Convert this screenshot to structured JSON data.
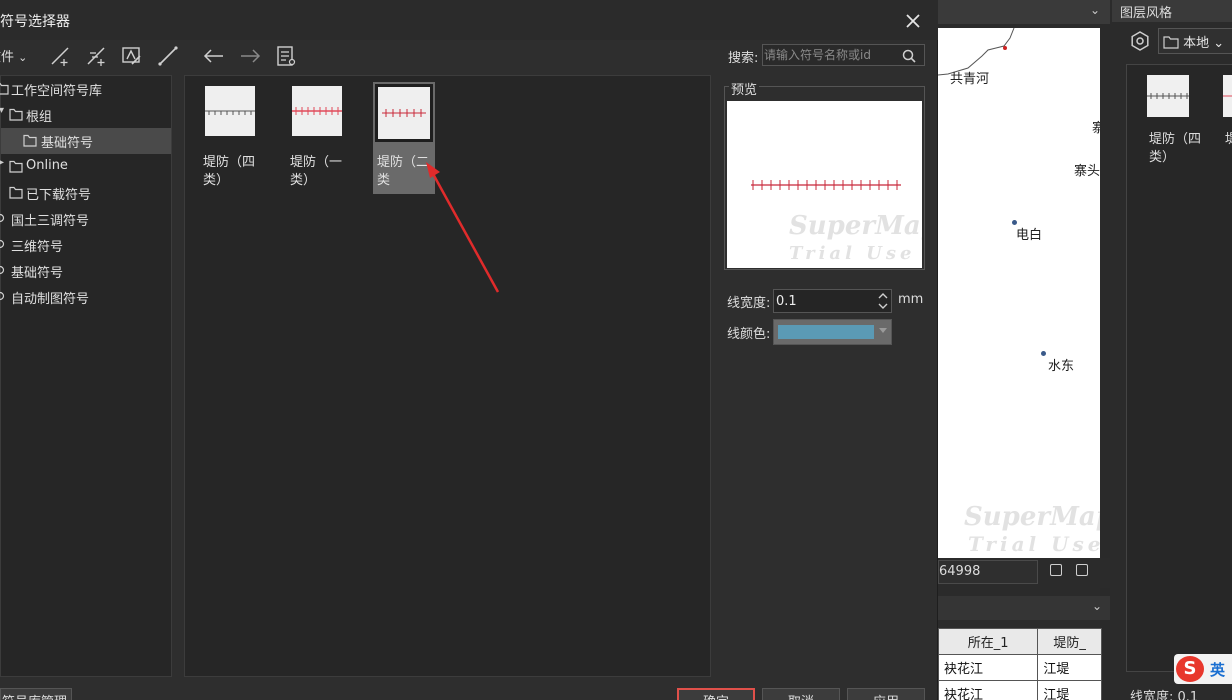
{
  "dialog": {
    "title": "符号选择器",
    "close_label": "✕",
    "toolbar": {
      "file_menu": "文件",
      "search_label": "搜索:",
      "search_placeholder": "请输入符号名称或id"
    },
    "tree": [
      {
        "label": "工作空间符号库",
        "kind": "folder"
      },
      {
        "label": "根组",
        "kind": "folder"
      },
      {
        "label": "基础符号",
        "kind": "folder",
        "selected": true
      },
      {
        "label": "Online",
        "kind": "folder"
      },
      {
        "label": "已下载符号",
        "kind": "folder"
      },
      {
        "label": "国土三调符号",
        "kind": "online"
      },
      {
        "label": "三维符号",
        "kind": "online"
      },
      {
        "label": "基础符号",
        "kind": "online"
      },
      {
        "label": "自动制图符号",
        "kind": "online"
      }
    ],
    "symbols": [
      {
        "label": "堤防（四类）",
        "color": "#555555",
        "selected": false
      },
      {
        "label": "堤防（一类）",
        "color": "#e04a5a",
        "selected": false
      },
      {
        "label": "堤防（二类",
        "color": "#c8283a",
        "selected": true
      }
    ],
    "preview": {
      "label": "预览",
      "line_color": "#c8283a",
      "watermark_line1": "SuperMap",
      "watermark_line2": "Trial Use"
    },
    "line_width": {
      "label": "线宽度:",
      "value": "0.1",
      "unit": "mm"
    },
    "line_color": {
      "label": "线颜色:",
      "value": "#5b9ab5"
    },
    "footer": {
      "manage_button": "符号库管理",
      "ok_button": "确定",
      "cancel_button": "取消",
      "apply_button": "应用"
    }
  },
  "map": {
    "labels": [
      "共青河",
      "寨",
      "寨头",
      "电白",
      "水东"
    ],
    "watermark_line1": "SuperMap",
    "watermark_line2": "Trial Use",
    "coordinate": "64998"
  },
  "attribute_table": {
    "headers": [
      "所在_1",
      "堤防_"
    ],
    "rows": [
      [
        "袂花江",
        "江堤"
      ],
      [
        "袂花江",
        "江堤"
      ]
    ]
  },
  "style_panel": {
    "title": "图层风格",
    "source": "本地",
    "item_label": "堤防（四类）",
    "item_label_2": "堤",
    "line_width_label": "线宽度:",
    "line_width_value": "0.1"
  },
  "ime": {
    "logo": "S",
    "lang": "英"
  }
}
